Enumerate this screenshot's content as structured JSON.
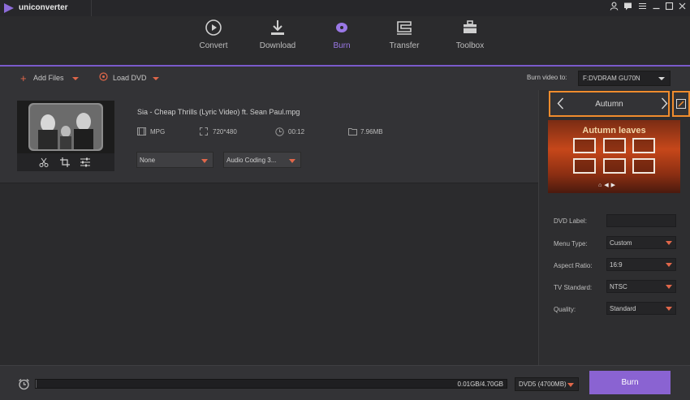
{
  "app": {
    "title": "uniconverter"
  },
  "window_controls": [
    "user-icon",
    "feedback-icon",
    "menu-icon",
    "minimize-icon",
    "maximize-icon",
    "close-icon"
  ],
  "nav": {
    "tabs": [
      {
        "label": "Convert",
        "icon": "convert-icon"
      },
      {
        "label": "Download",
        "icon": "download-icon"
      },
      {
        "label": "Burn",
        "icon": "burn-icon",
        "active": true
      },
      {
        "label": "Transfer",
        "icon": "transfer-icon"
      },
      {
        "label": "Toolbox",
        "icon": "toolbox-icon"
      }
    ]
  },
  "toolbar": {
    "add_files": "Add Files",
    "load_dvd": "Load DVD",
    "burn_to_label": "Burn video to:",
    "burn_to_value": "F:DVDRAM GU70N"
  },
  "file": {
    "name": "Sia - Cheap Thrills (Lyric Video) ft. Sean Paul.mpg",
    "format": "MPG",
    "resolution": "720*480",
    "duration": "00:12",
    "size": "7.96MB",
    "subtitle_select": "None",
    "audio_select": "Audio Coding 3..."
  },
  "template": {
    "name": "Autumn",
    "preview_title": "Autumn leaves"
  },
  "settings": {
    "dvd_label": {
      "label": "DVD Label:",
      "value": ""
    },
    "menu_type": {
      "label": "Menu Type:",
      "value": "Custom"
    },
    "aspect_ratio": {
      "label": "Aspect Ratio:",
      "value": "16:9"
    },
    "tv_standard": {
      "label": "TV Standard:",
      "value": "NTSC"
    },
    "quality": {
      "label": "Quality:",
      "value": "Standard"
    }
  },
  "bottom": {
    "progress_text": "0.01GB/4.70GB",
    "progress_fraction": 0.002,
    "disc": "DVD5 (4700MB)",
    "burn_button": "Burn"
  },
  "colors": {
    "accent": "#8a63d2",
    "highlight": "#f08c2d",
    "caret": "#e0674a"
  }
}
